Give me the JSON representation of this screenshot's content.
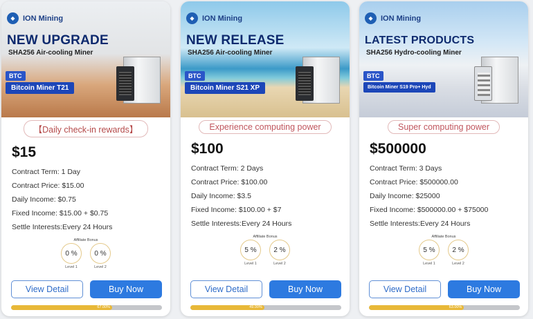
{
  "colors": {
    "accent": "#2d7ae0",
    "brand": "#1c3f86",
    "progress": "#e8b838"
  },
  "cards": [
    {
      "brand": "ION Mining",
      "brand_icon": "ion-logo-icon",
      "headline": "NEW UPGRADE",
      "subline": "SHA256  Air-cooling Miner",
      "coin": "BTC",
      "model": "Bitcoin Miner T21",
      "slogan": "【Daily check-in rewards】",
      "price": "$15",
      "details": [
        "Contract Term: 1 Day",
        "Contract Price: $15.00",
        "Daily Income: $0.75",
        "Fixed Income: $15.00 + $0.75",
        "Settle Interests:Every 24 Hours"
      ],
      "bonus_title": "Affiliate Bonus",
      "bonus": [
        {
          "value": "0 %",
          "level": "Level 1"
        },
        {
          "value": "0 %",
          "level": "Level 2"
        }
      ],
      "view_label": "View Detail",
      "buy_label": "Buy Now",
      "progress": 0.67,
      "progress_text": "67.00%"
    },
    {
      "brand": "ION Mining",
      "brand_icon": "ion-logo-icon",
      "headline": "NEW RELEASE",
      "subline": "SHA256  Air-cooling Miner",
      "coin": "BTC",
      "model": "Bitcoin Miner S21 XP",
      "slogan": "Experience computing power",
      "price": "$100",
      "details": [
        "Contract Term: 2 Days",
        "Contract Price: $100.00",
        "Daily Income: $3.5",
        "Fixed Income: $100.00 + $7",
        "Settle Interests:Every 24 Hours"
      ],
      "bonus_title": "Affiliate Bonus",
      "bonus": [
        {
          "value": "5 %",
          "level": "Level 1"
        },
        {
          "value": "2 %",
          "level": "Level 2"
        }
      ],
      "view_label": "View Detail",
      "buy_label": "Buy Now",
      "progress": 0.49,
      "progress_text": "49.00%"
    },
    {
      "brand": "ION Mining",
      "brand_icon": "ion-logo-icon",
      "headline": "LATEST PRODUCTS",
      "subline": "SHA256 Hydro-cooling Miner",
      "coin": "BTC",
      "model": "Bitcoin Miner S19 Pro+ Hyd",
      "slogan": "Super computing power",
      "price": "$500000",
      "details": [
        "Contract Term: 3 Days",
        "Contract Price: $500000.00",
        "Daily Income: $25000",
        "Fixed Income: $500000.00 + $75000",
        "Settle Interests:Every 24 Hours"
      ],
      "bonus_title": "Affiliate Bonus",
      "bonus": [
        {
          "value": "5 %",
          "level": "Level 1"
        },
        {
          "value": "2 %",
          "level": "Level 2"
        }
      ],
      "view_label": "View Detail",
      "buy_label": "Buy Now",
      "progress": 0.63,
      "progress_text": "63.00%"
    }
  ]
}
